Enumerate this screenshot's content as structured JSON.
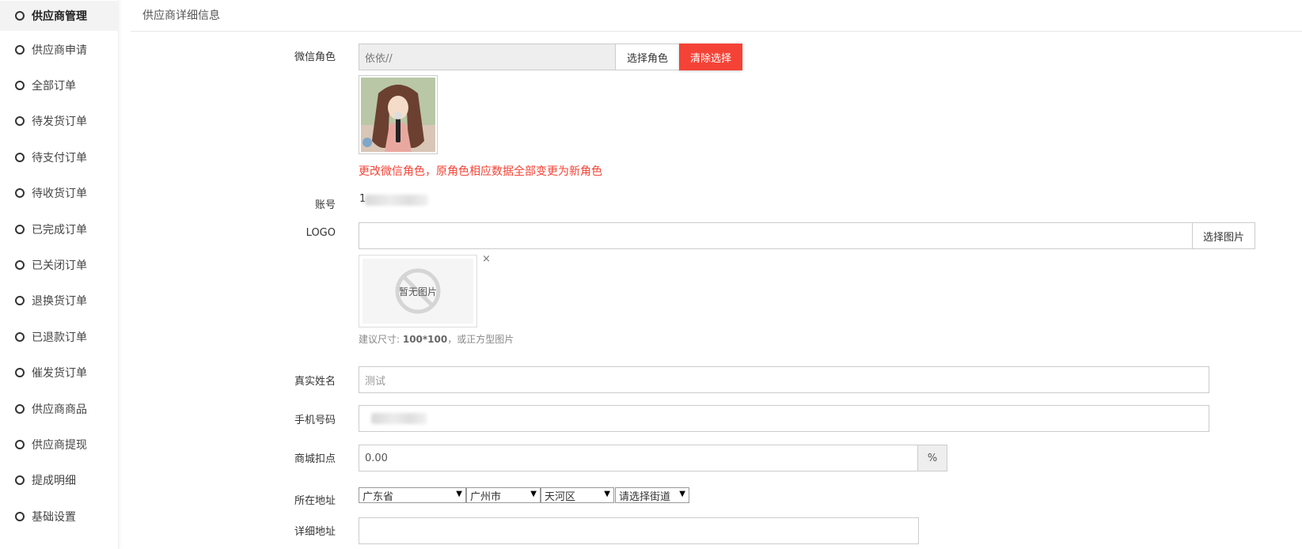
{
  "sidebar": {
    "items": [
      {
        "label": "供应商管理",
        "active": true
      },
      {
        "label": "供应商申请"
      },
      {
        "label": "全部订单"
      },
      {
        "label": "待发货订单"
      },
      {
        "label": "待支付订单"
      },
      {
        "label": "待收货订单"
      },
      {
        "label": "已完成订单"
      },
      {
        "label": "已关闭订单"
      },
      {
        "label": "退换货订单"
      },
      {
        "label": "已退款订单"
      },
      {
        "label": "催发货订单"
      },
      {
        "label": "供应商商品"
      },
      {
        "label": "供应商提现"
      },
      {
        "label": "提成明细"
      },
      {
        "label": "基础设置"
      }
    ]
  },
  "header": {
    "title": "供应商详细信息"
  },
  "form": {
    "wechat_role": {
      "label": "微信角色",
      "value": "依依//",
      "select_button": "选择角色",
      "clear_button": "清除选择",
      "warning": "更改微信角色，原角色相应数据全部变更为新角色"
    },
    "account": {
      "label": "账号",
      "value_prefix": "1"
    },
    "logo": {
      "label": "LOGO",
      "value": "",
      "select_button": "选择图片",
      "no_image_text": "暂无图片",
      "remove": "×",
      "hint_prefix": "建议尺寸: ",
      "hint_size": "100*100",
      "hint_suffix": "，或正方型图片"
    },
    "real_name": {
      "label": "真实姓名",
      "placeholder": "测试"
    },
    "phone": {
      "label": "手机号码"
    },
    "deduction": {
      "label": "商城扣点",
      "value": "0.00",
      "unit": "%"
    },
    "address": {
      "label": "所在地址",
      "province": "广东省",
      "city": "广州市",
      "district": "天河区",
      "street": "请选择街道"
    },
    "detail_address": {
      "label": "详细地址",
      "value": ""
    }
  },
  "colors": {
    "danger": "#f44336",
    "active_nav_bg": "#f3f3f3"
  }
}
